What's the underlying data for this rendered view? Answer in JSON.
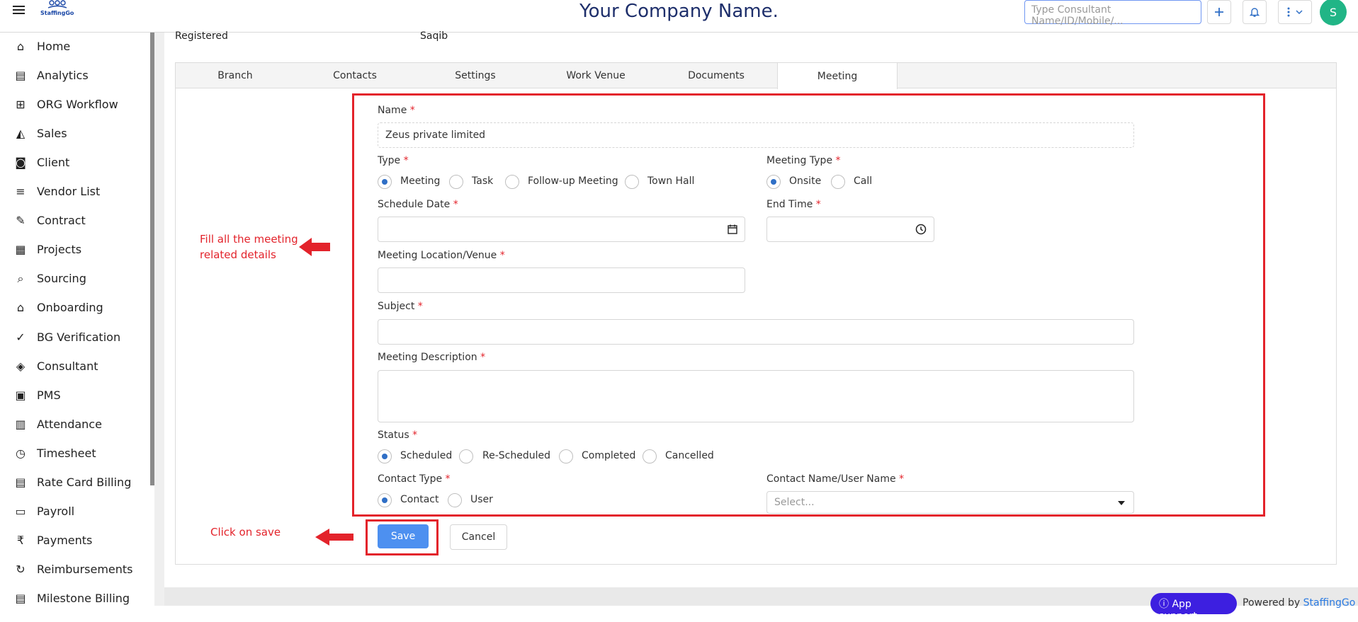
{
  "header": {
    "company_title": "Your Company Name.",
    "logo_text": "StaffingGo",
    "search_placeholder": "Type Consultant Name/ID/Mobile/...",
    "avatar_initial": "S"
  },
  "sidebar": {
    "items": [
      {
        "label": "Home",
        "icon": "home-icon"
      },
      {
        "label": "Analytics",
        "icon": "analytics-icon"
      },
      {
        "label": "ORG Workflow",
        "icon": "org-workflow-icon"
      },
      {
        "label": "Sales",
        "icon": "sales-icon"
      },
      {
        "label": "Client",
        "icon": "client-icon"
      },
      {
        "label": "Vendor List",
        "icon": "vendor-list-icon"
      },
      {
        "label": "Contract",
        "icon": "contract-icon"
      },
      {
        "label": "Projects",
        "icon": "projects-icon"
      },
      {
        "label": "Sourcing",
        "icon": "sourcing-icon"
      },
      {
        "label": "Onboarding",
        "icon": "onboarding-icon"
      },
      {
        "label": "BG Verification",
        "icon": "bg-verification-icon"
      },
      {
        "label": "Consultant",
        "icon": "consultant-icon"
      },
      {
        "label": "PMS",
        "icon": "pms-icon"
      },
      {
        "label": "Attendance",
        "icon": "attendance-icon"
      },
      {
        "label": "Timesheet",
        "icon": "timesheet-icon"
      },
      {
        "label": "Rate Card Billing",
        "icon": "rate-card-icon"
      },
      {
        "label": "Payroll",
        "icon": "payroll-icon"
      },
      {
        "label": "Payments",
        "icon": "rupee-icon"
      },
      {
        "label": "Reimbursements",
        "icon": "reimbursements-icon"
      },
      {
        "label": "Milestone Billing",
        "icon": "milestone-billing-icon"
      }
    ]
  },
  "info": {
    "registered_label": "Registered",
    "registered_value": "Saqib"
  },
  "tabs": [
    "Branch",
    "Contacts",
    "Settings",
    "Work Venue",
    "Documents",
    "Meeting"
  ],
  "active_tab": "Meeting",
  "form": {
    "name_label": "Name",
    "name_value": "Zeus private limited",
    "type_label": "Type",
    "type_options": [
      "Meeting",
      "Task",
      "Follow-up Meeting",
      "Town Hall"
    ],
    "type_selected": "Meeting",
    "meeting_type_label": "Meeting Type",
    "meeting_type_options": [
      "Onsite",
      "Call"
    ],
    "meeting_type_selected": "Onsite",
    "schedule_date_label": "Schedule Date",
    "end_time_label": "End Time",
    "location_label": "Meeting Location/Venue",
    "subject_label": "Subject",
    "description_label": "Meeting Description",
    "status_label": "Status",
    "status_options": [
      "Scheduled",
      "Re-Scheduled",
      "Completed",
      "Cancelled"
    ],
    "status_selected": "Scheduled",
    "contact_type_label": "Contact Type",
    "contact_type_options": [
      "Contact",
      "User"
    ],
    "contact_type_selected": "Contact",
    "contact_name_label": "Contact Name/User Name",
    "contact_name_placeholder": "Select...",
    "required_mark": "*",
    "save_label": "Save",
    "cancel_label": "Cancel"
  },
  "annotations": {
    "fill_details": "Fill all the meeting related details",
    "click_save": "Click on save"
  },
  "footer": {
    "app_support": "App support",
    "powered_by": "Powered by",
    "brand": "StaffingGo"
  },
  "colors": {
    "accent": "#4d90f0",
    "annotation_red": "#e3232b",
    "avatar": "#21b586",
    "title": "#1e2f6b"
  }
}
